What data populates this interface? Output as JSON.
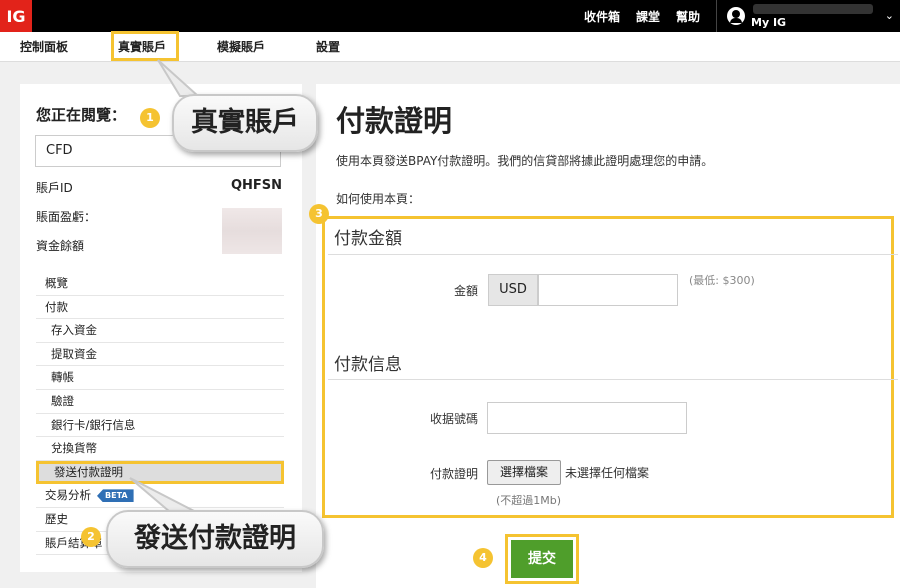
{
  "header": {
    "logo": "IG",
    "links": [
      "收件箱",
      "課堂",
      "幫助"
    ],
    "account_label": "My IG",
    "caret": "⌄"
  },
  "nav": {
    "items": [
      "控制面板",
      "真實賬戶",
      "模擬賬戶",
      "設置"
    ],
    "active": "真實賬戶"
  },
  "sidebar": {
    "viewing_label": "您正在閱覽：",
    "account_type": "CFD",
    "account_id_label": "賬戶ID",
    "account_id_value": "QHFSN",
    "pnl_label": "賬面盈虧：",
    "balance_label": "資金餘額",
    "menu": [
      {
        "label": "概覽",
        "sub": false
      },
      {
        "label": "付款",
        "sub": false
      },
      {
        "label": "存入資金",
        "sub": true
      },
      {
        "label": "提取資金",
        "sub": true
      },
      {
        "label": "轉帳",
        "sub": true
      },
      {
        "label": "驗證",
        "sub": true
      },
      {
        "label": "銀行卡/銀行信息",
        "sub": true
      },
      {
        "label": "兌換貨幣",
        "sub": true
      },
      {
        "label": "發送付款證明",
        "sub": true,
        "active": true
      },
      {
        "label": "交易分析",
        "sub": false,
        "badge": "BETA"
      },
      {
        "label": "歷史",
        "sub": false
      },
      {
        "label": "賬戶結算單",
        "sub": false
      }
    ]
  },
  "main": {
    "title": "付款證明",
    "description": "使用本頁發送BPAY付款證明。我們的信貸部將據此證明處理您的申請。",
    "howto": "如何使用本頁：",
    "amount_section_title": "付款金額",
    "amount_label": "金額",
    "currency": "USD",
    "amount_value": "",
    "min_note": "(最低: $300)",
    "info_section_title": "付款信息",
    "receipt_label": "收据號碼",
    "receipt_value": "",
    "proof_label": "付款證明",
    "file_button": "選擇檔案",
    "file_status": "未選擇任何檔案",
    "size_note": "(不超過1Mb)",
    "submit": "提交"
  },
  "annotations": {
    "badges": [
      "1",
      "2",
      "3",
      "4"
    ],
    "callout_account": "真實賬戶",
    "callout_proof": "發送付款證明"
  },
  "colors": {
    "highlight": "#f5c331",
    "brand_red": "#e2231a",
    "submit_green": "#4f9e2b"
  }
}
